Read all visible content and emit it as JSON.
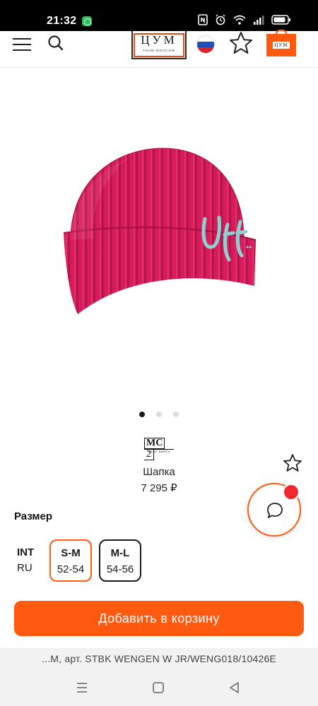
{
  "status_bar": {
    "time": "21:32"
  },
  "header": {
    "logo_text": "ЦУМ",
    "logo_subtext": "TSUM MOSCOW",
    "cart_logo_text": "ЦУМ",
    "icons": [
      "menu-icon",
      "search-icon",
      "russia-flag-icon",
      "star-icon",
      "shopping-bag-icon"
    ]
  },
  "product": {
    "image_description_icon": "beanie-icon",
    "image_colors": {
      "knit": "#d81b5a",
      "embroidery": "#8fd1cf"
    },
    "embroidery_text": "Uff",
    "carousel": {
      "count": 3,
      "active_index": 0
    },
    "brand_logo_text": "MC2",
    "brand_logo_subtext": "SAINT BARTH",
    "name": "Шапка",
    "price": "7 295 ₽"
  },
  "sizes": {
    "title": "Размер",
    "system_int": "INT",
    "system_ru": "RU",
    "options": [
      {
        "int": "S-M",
        "ru": "52-54",
        "selected": true
      },
      {
        "int": "M-L",
        "ru": "54-56",
        "selected": false
      }
    ]
  },
  "actions": {
    "add_to_cart": "Добавить в корзину"
  },
  "sku_text": "...M, арт. STBK WENGEN W JR/WENG018/10426E",
  "colors": {
    "accent": "#ff5a10",
    "badge": "#f0282d"
  }
}
